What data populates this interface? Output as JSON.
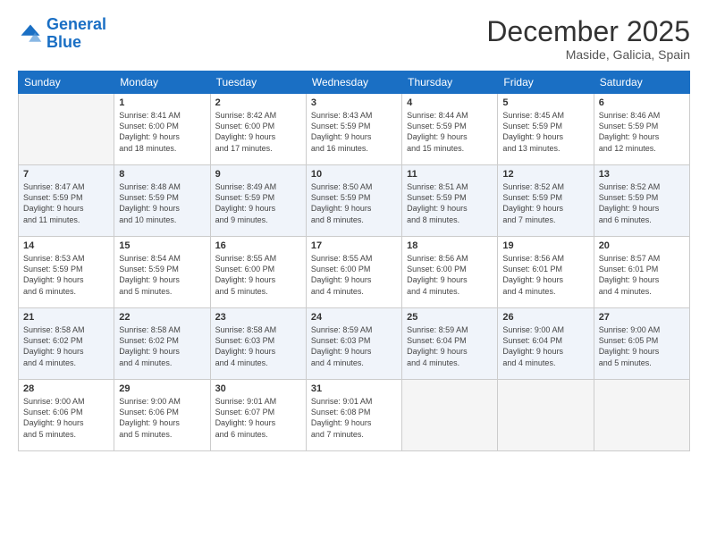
{
  "header": {
    "logo_line1": "General",
    "logo_line2": "Blue",
    "month": "December 2025",
    "location": "Maside, Galicia, Spain"
  },
  "weekdays": [
    "Sunday",
    "Monday",
    "Tuesday",
    "Wednesday",
    "Thursday",
    "Friday",
    "Saturday"
  ],
  "weeks": [
    [
      {
        "day": "",
        "info": ""
      },
      {
        "day": "1",
        "info": "Sunrise: 8:41 AM\nSunset: 6:00 PM\nDaylight: 9 hours\nand 18 minutes."
      },
      {
        "day": "2",
        "info": "Sunrise: 8:42 AM\nSunset: 6:00 PM\nDaylight: 9 hours\nand 17 minutes."
      },
      {
        "day": "3",
        "info": "Sunrise: 8:43 AM\nSunset: 5:59 PM\nDaylight: 9 hours\nand 16 minutes."
      },
      {
        "day": "4",
        "info": "Sunrise: 8:44 AM\nSunset: 5:59 PM\nDaylight: 9 hours\nand 15 minutes."
      },
      {
        "day": "5",
        "info": "Sunrise: 8:45 AM\nSunset: 5:59 PM\nDaylight: 9 hours\nand 13 minutes."
      },
      {
        "day": "6",
        "info": "Sunrise: 8:46 AM\nSunset: 5:59 PM\nDaylight: 9 hours\nand 12 minutes."
      }
    ],
    [
      {
        "day": "7",
        "info": "Sunrise: 8:47 AM\nSunset: 5:59 PM\nDaylight: 9 hours\nand 11 minutes."
      },
      {
        "day": "8",
        "info": "Sunrise: 8:48 AM\nSunset: 5:59 PM\nDaylight: 9 hours\nand 10 minutes."
      },
      {
        "day": "9",
        "info": "Sunrise: 8:49 AM\nSunset: 5:59 PM\nDaylight: 9 hours\nand 9 minutes."
      },
      {
        "day": "10",
        "info": "Sunrise: 8:50 AM\nSunset: 5:59 PM\nDaylight: 9 hours\nand 8 minutes."
      },
      {
        "day": "11",
        "info": "Sunrise: 8:51 AM\nSunset: 5:59 PM\nDaylight: 9 hours\nand 8 minutes."
      },
      {
        "day": "12",
        "info": "Sunrise: 8:52 AM\nSunset: 5:59 PM\nDaylight: 9 hours\nand 7 minutes."
      },
      {
        "day": "13",
        "info": "Sunrise: 8:52 AM\nSunset: 5:59 PM\nDaylight: 9 hours\nand 6 minutes."
      }
    ],
    [
      {
        "day": "14",
        "info": "Sunrise: 8:53 AM\nSunset: 5:59 PM\nDaylight: 9 hours\nand 6 minutes."
      },
      {
        "day": "15",
        "info": "Sunrise: 8:54 AM\nSunset: 5:59 PM\nDaylight: 9 hours\nand 5 minutes."
      },
      {
        "day": "16",
        "info": "Sunrise: 8:55 AM\nSunset: 6:00 PM\nDaylight: 9 hours\nand 5 minutes."
      },
      {
        "day": "17",
        "info": "Sunrise: 8:55 AM\nSunset: 6:00 PM\nDaylight: 9 hours\nand 4 minutes."
      },
      {
        "day": "18",
        "info": "Sunrise: 8:56 AM\nSunset: 6:00 PM\nDaylight: 9 hours\nand 4 minutes."
      },
      {
        "day": "19",
        "info": "Sunrise: 8:56 AM\nSunset: 6:01 PM\nDaylight: 9 hours\nand 4 minutes."
      },
      {
        "day": "20",
        "info": "Sunrise: 8:57 AM\nSunset: 6:01 PM\nDaylight: 9 hours\nand 4 minutes."
      }
    ],
    [
      {
        "day": "21",
        "info": "Sunrise: 8:58 AM\nSunset: 6:02 PM\nDaylight: 9 hours\nand 4 minutes."
      },
      {
        "day": "22",
        "info": "Sunrise: 8:58 AM\nSunset: 6:02 PM\nDaylight: 9 hours\nand 4 minutes."
      },
      {
        "day": "23",
        "info": "Sunrise: 8:58 AM\nSunset: 6:03 PM\nDaylight: 9 hours\nand 4 minutes."
      },
      {
        "day": "24",
        "info": "Sunrise: 8:59 AM\nSunset: 6:03 PM\nDaylight: 9 hours\nand 4 minutes."
      },
      {
        "day": "25",
        "info": "Sunrise: 8:59 AM\nSunset: 6:04 PM\nDaylight: 9 hours\nand 4 minutes."
      },
      {
        "day": "26",
        "info": "Sunrise: 9:00 AM\nSunset: 6:04 PM\nDaylight: 9 hours\nand 4 minutes."
      },
      {
        "day": "27",
        "info": "Sunrise: 9:00 AM\nSunset: 6:05 PM\nDaylight: 9 hours\nand 5 minutes."
      }
    ],
    [
      {
        "day": "28",
        "info": "Sunrise: 9:00 AM\nSunset: 6:06 PM\nDaylight: 9 hours\nand 5 minutes."
      },
      {
        "day": "29",
        "info": "Sunrise: 9:00 AM\nSunset: 6:06 PM\nDaylight: 9 hours\nand 5 minutes."
      },
      {
        "day": "30",
        "info": "Sunrise: 9:01 AM\nSunset: 6:07 PM\nDaylight: 9 hours\nand 6 minutes."
      },
      {
        "day": "31",
        "info": "Sunrise: 9:01 AM\nSunset: 6:08 PM\nDaylight: 9 hours\nand 7 minutes."
      },
      {
        "day": "",
        "info": ""
      },
      {
        "day": "",
        "info": ""
      },
      {
        "day": "",
        "info": ""
      }
    ]
  ]
}
